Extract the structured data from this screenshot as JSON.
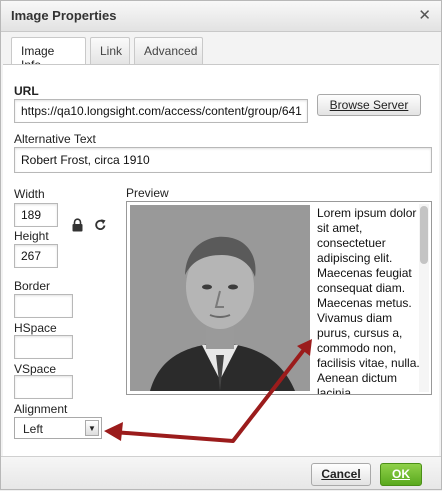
{
  "dialog": {
    "title": "Image Properties",
    "close_glyph": "✕"
  },
  "tabs": [
    {
      "label": "Image Info",
      "active": true
    },
    {
      "label": "Link",
      "active": false
    },
    {
      "label": "Advanced",
      "active": false
    }
  ],
  "url": {
    "label": "URL",
    "value": "https://qa10.longsight.com/access/content/group/641"
  },
  "browse_button": "Browse Server",
  "alt_text": {
    "label": "Alternative Text",
    "value": "Robert Frost, circa 1910"
  },
  "width": {
    "label": "Width",
    "value": "189"
  },
  "height": {
    "label": "Height",
    "value": "267"
  },
  "border": {
    "label": "Border",
    "value": ""
  },
  "hspace": {
    "label": "HSpace",
    "value": ""
  },
  "vspace": {
    "label": "VSpace",
    "value": ""
  },
  "alignment": {
    "label": "Alignment",
    "value": "Left"
  },
  "preview": {
    "label": "Preview",
    "text": "Lorem ipsum dolor sit amet, consectetuer adipiscing elit. Maecenas feugiat consequat diam. Maecenas metus. Vivamus diam purus, cursus a, commodo non, facilisis vitae, nulla. Aenean dictum lacinia"
  },
  "footer": {
    "cancel": "Cancel",
    "ok": "OK"
  },
  "colors": {
    "ok_green": "#5aa91e",
    "annotation_arrow": "#9b1c1c"
  },
  "icons": {
    "lock": "lock-icon",
    "reset": "refresh-icon"
  }
}
